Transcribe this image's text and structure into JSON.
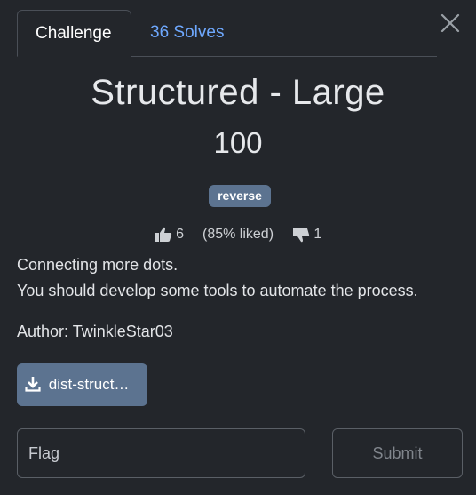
{
  "tabs": [
    {
      "label": "Challenge",
      "active": true
    },
    {
      "label": "36 Solves",
      "active": false
    }
  ],
  "challenge": {
    "title": "Structured - Large",
    "points": "100",
    "tag": "reverse",
    "likes": "6",
    "liked_text": "(85% liked)",
    "dislikes": "1",
    "description_lines": [
      "Connecting more dots.",
      "You should develop some tools to automate the process."
    ],
    "author": "Author: TwinkleStar03",
    "file_label": "dist-struct…"
  },
  "form": {
    "flag_placeholder": "Flag",
    "submit_label": "Submit"
  },
  "colors": {
    "background": "#23262b",
    "tab_link": "#6ea8fe",
    "tag_bg": "#5c7390",
    "button_bg": "#5c7390"
  },
  "icons": {
    "close": "close-icon",
    "like": "thumbs-up-icon",
    "dislike": "thumbs-down-icon",
    "download": "download-icon"
  }
}
